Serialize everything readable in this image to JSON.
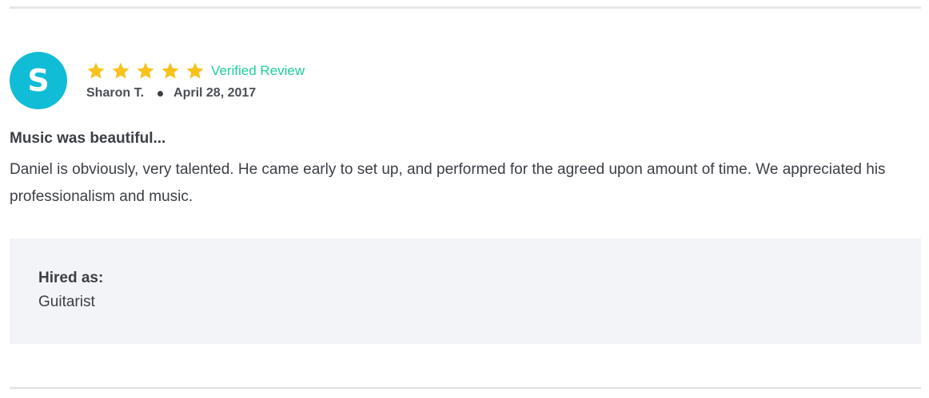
{
  "review": {
    "avatar_initial": "S",
    "avatar_color": "#10bcd6",
    "rating": 5,
    "rating_max": 5,
    "star_color": "#f7c21a",
    "verified_label": "Verified Review",
    "verified_color": "#1dcf9e",
    "author": "Sharon T.",
    "date": "April 28, 2017",
    "title": "Music was beautiful...",
    "body": "Daniel is obviously, very talented. He came early to set up, and performed for the agreed upon amount of time. We appreciated his professionalism and music."
  },
  "hired": {
    "label": "Hired as:",
    "value": "Guitarist"
  }
}
